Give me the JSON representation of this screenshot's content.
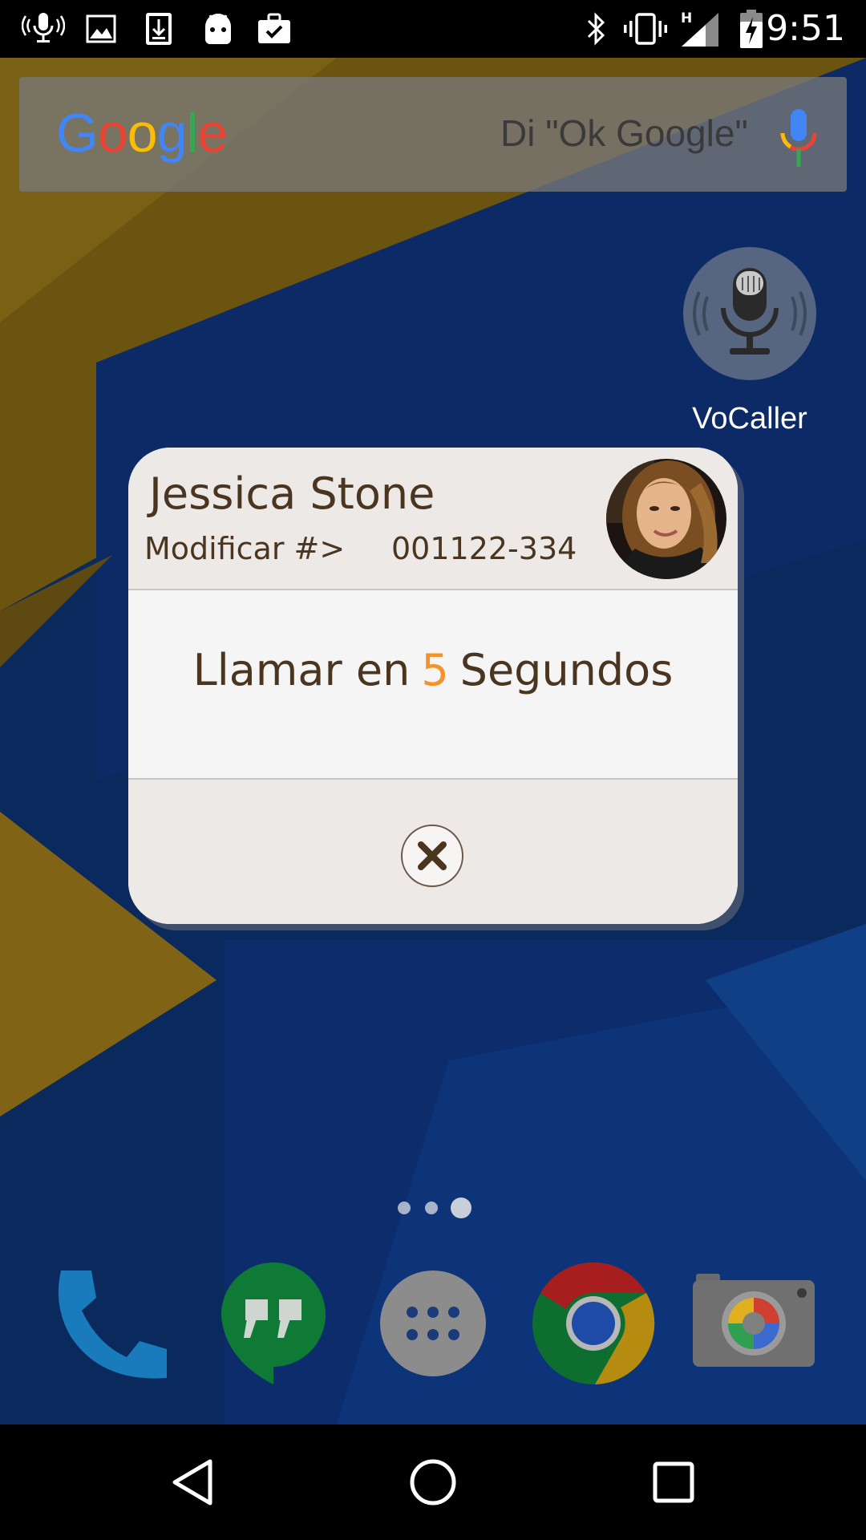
{
  "status_bar": {
    "time": "9:51",
    "network_type": "H",
    "notification_icons": [
      "voice-search-icon",
      "image-icon",
      "download-icon",
      "android-icon",
      "briefcase-check-icon"
    ],
    "system_icons": [
      "bluetooth-icon",
      "vibrate-icon",
      "signal-icon",
      "battery-charging-icon"
    ]
  },
  "search_bar": {
    "logo": [
      "G",
      "o",
      "o",
      "g",
      "l",
      "e"
    ],
    "logo_colors": [
      "#4285F4",
      "#EA4335",
      "#FBBC05",
      "#4285F4",
      "#34A853",
      "#EA4335"
    ],
    "hint": "Di \"Ok Google\""
  },
  "home_app": {
    "label": "VoCaller",
    "icon": "microphone-icon"
  },
  "dialog": {
    "contact_name": "Jessica Stone",
    "modify_label": "Modificar #>",
    "phone_number": "001122-334",
    "countdown_prefix": "Llamar en",
    "countdown_value": "5",
    "countdown_suffix": "Segundos",
    "countdown_color": "#f5922a",
    "cancel_icon": "close-icon"
  },
  "home_pages": {
    "count": 3,
    "active_index": 2
  },
  "dock": {
    "apps": [
      "phone-icon",
      "hangouts-icon",
      "app-drawer-icon",
      "chrome-icon",
      "camera-icon"
    ]
  },
  "nav_bar": {
    "buttons": [
      "back-icon",
      "home-icon",
      "recents-icon"
    ]
  }
}
